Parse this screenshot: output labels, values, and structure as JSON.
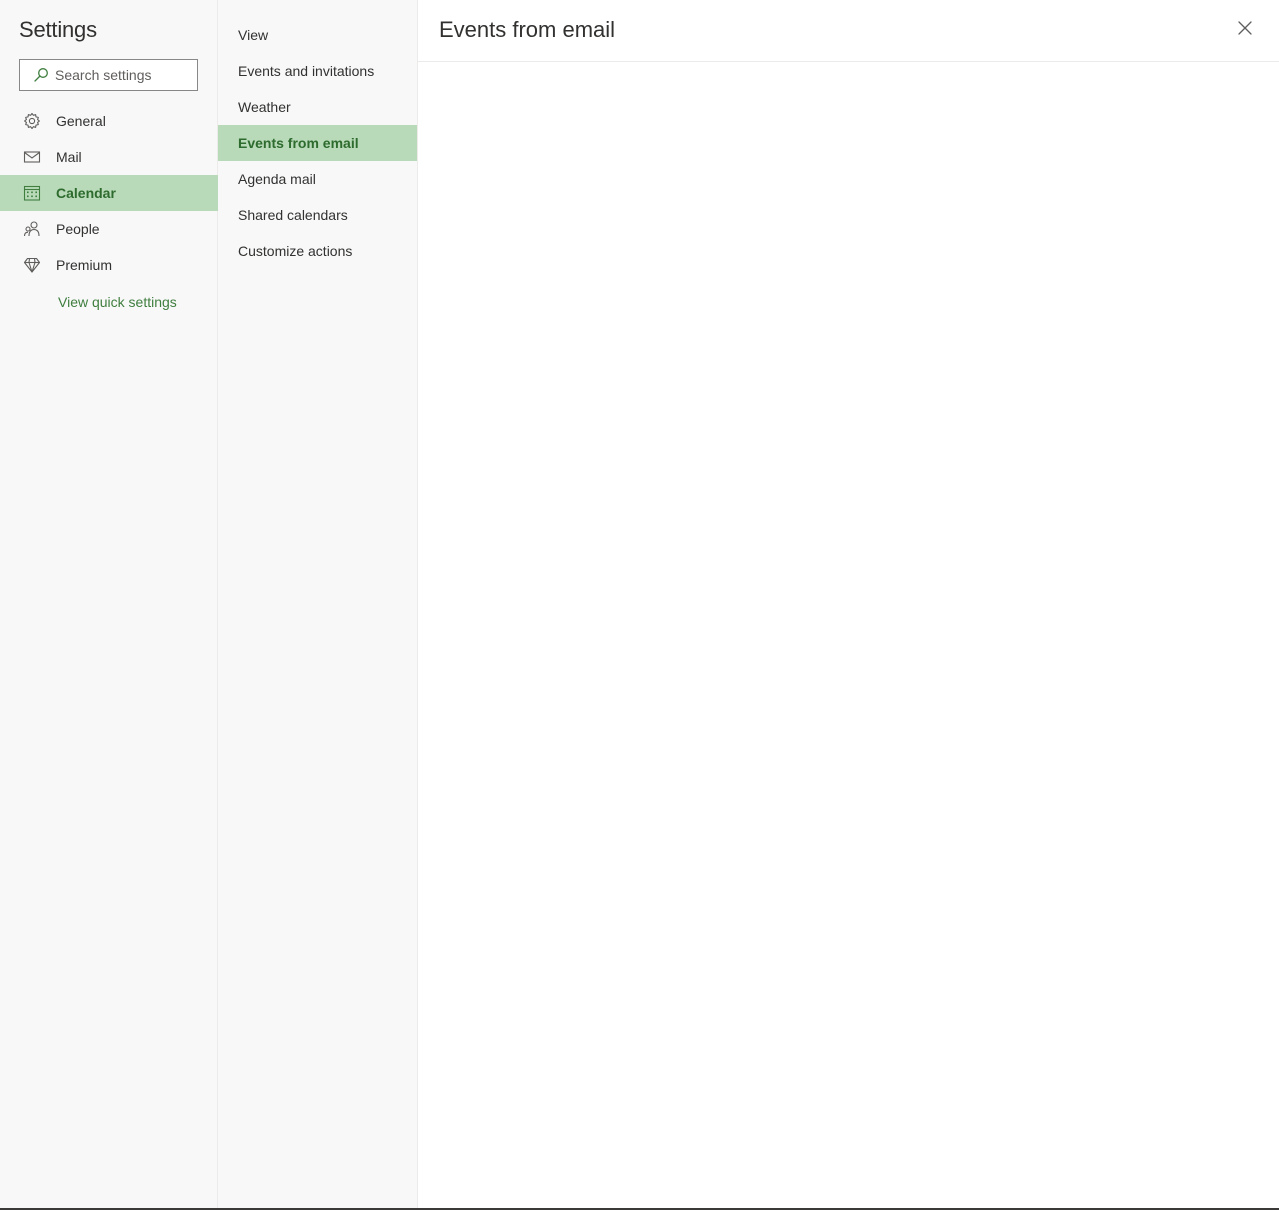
{
  "nav": {
    "title": "Settings",
    "search": {
      "placeholder": "Search settings",
      "value": ""
    },
    "items": [
      {
        "label": "General",
        "icon": "gear-icon",
        "selected": false
      },
      {
        "label": "Mail",
        "icon": "mail-icon",
        "selected": false
      },
      {
        "label": "Calendar",
        "icon": "calendar-icon",
        "selected": true
      },
      {
        "label": "People",
        "icon": "people-icon",
        "selected": false
      },
      {
        "label": "Premium",
        "icon": "diamond-icon",
        "selected": false
      }
    ],
    "quick_link": "View quick settings"
  },
  "subnav": {
    "items": [
      {
        "label": "View",
        "selected": false
      },
      {
        "label": "Events and invitations",
        "selected": false
      },
      {
        "label": "Weather",
        "selected": false
      },
      {
        "label": "Events from email",
        "selected": true
      },
      {
        "label": "Agenda mail",
        "selected": false
      },
      {
        "label": "Shared calendars",
        "selected": false
      },
      {
        "label": "Customize actions",
        "selected": false
      }
    ]
  },
  "content": {
    "title": "Events from email",
    "close_icon": "close-icon"
  },
  "colors": {
    "accent": "#3f7e3f",
    "selected_bg": "#b8dab8",
    "selected_text": "#2e6b2e",
    "pane_bg": "#f8f8f8"
  }
}
